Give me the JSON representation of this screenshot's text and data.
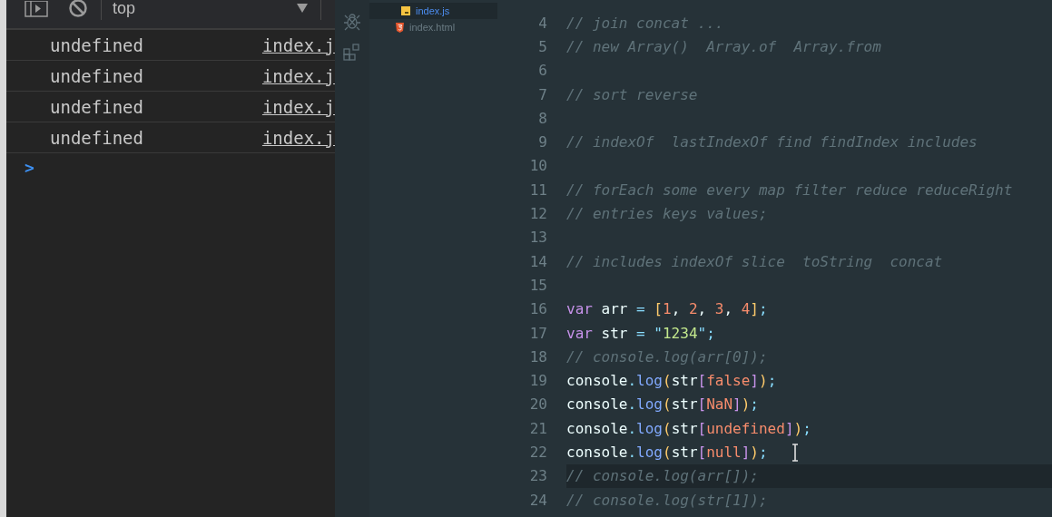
{
  "console": {
    "toolbar": {
      "context": "top"
    },
    "messages": [
      {
        "text": "undefined",
        "source": "index.j"
      },
      {
        "text": "undefined",
        "source": "index.j"
      },
      {
        "text": "undefined",
        "source": "index.j"
      },
      {
        "text": "undefined",
        "source": "index.j"
      }
    ],
    "prompt": ">"
  },
  "file_tree": {
    "items": [
      {
        "name": "index.js",
        "kind": "js",
        "selected": true
      },
      {
        "name": "index.html",
        "kind": "html",
        "selected": false
      }
    ]
  },
  "editor": {
    "lines": [
      {
        "number": "4",
        "current": false,
        "tokens": [
          {
            "text": "// join concat ...",
            "kind": "comment"
          }
        ]
      },
      {
        "number": "5",
        "current": false,
        "tokens": [
          {
            "text": "// new Array()  Array.of  Array.from",
            "kind": "comment"
          }
        ]
      },
      {
        "number": "6",
        "current": false
      },
      {
        "number": "7",
        "current": false,
        "tokens": [
          {
            "text": "// sort reverse",
            "kind": "comment"
          }
        ]
      },
      {
        "number": "8",
        "current": false
      },
      {
        "number": "9",
        "current": false,
        "tokens": [
          {
            "text": "// indexOf  lastIndexOf find findIndex includes",
            "kind": "comment"
          }
        ]
      },
      {
        "number": "10",
        "current": false
      },
      {
        "number": "11",
        "current": false,
        "tokens": [
          {
            "text": "// forEach some every map filter reduce reduceRight",
            "kind": "comment"
          }
        ]
      },
      {
        "number": "12",
        "current": false,
        "tokens": [
          {
            "text": "// entries keys values;",
            "kind": "comment"
          }
        ]
      },
      {
        "number": "13",
        "current": false
      },
      {
        "number": "14",
        "current": false,
        "tokens": [
          {
            "text": "// includes indexOf slice  toString  concat",
            "kind": "comment"
          }
        ]
      },
      {
        "number": "15",
        "current": false
      },
      {
        "number": "16",
        "current": false,
        "tokens": [
          {
            "text": "var",
            "kind": "keyword"
          },
          {
            "text": " arr ",
            "kind": "plain"
          },
          {
            "text": "= ",
            "kind": "operator"
          },
          {
            "text": "[",
            "kind": "paren"
          },
          {
            "text": "1",
            "kind": "number"
          },
          {
            "text": ", ",
            "kind": "plain"
          },
          {
            "text": "2",
            "kind": "number"
          },
          {
            "text": ", ",
            "kind": "plain"
          },
          {
            "text": "3",
            "kind": "number"
          },
          {
            "text": ", ",
            "kind": "plain"
          },
          {
            "text": "4",
            "kind": "number"
          },
          {
            "text": "]",
            "kind": "paren"
          },
          {
            "text": ";",
            "kind": "punct"
          }
        ]
      },
      {
        "number": "17",
        "current": false,
        "tokens": [
          {
            "text": "var",
            "kind": "keyword"
          },
          {
            "text": " str ",
            "kind": "plain"
          },
          {
            "text": "= ",
            "kind": "operator"
          },
          {
            "text": "\"",
            "kind": "punct"
          },
          {
            "text": "1234",
            "kind": "string"
          },
          {
            "text": "\"",
            "kind": "punct"
          },
          {
            "text": ";",
            "kind": "punct"
          }
        ]
      },
      {
        "number": "18",
        "current": false,
        "tokens": [
          {
            "text": "// console.log(arr[0]);",
            "kind": "comment"
          }
        ]
      },
      {
        "number": "19",
        "current": false,
        "tokens": [
          {
            "text": "console",
            "kind": "plain"
          },
          {
            "text": ".",
            "kind": "punct"
          },
          {
            "text": "log",
            "kind": "method"
          },
          {
            "text": "(",
            "kind": "paren"
          },
          {
            "text": "str",
            "kind": "plain"
          },
          {
            "text": "[",
            "kind": "bracket"
          },
          {
            "text": "false",
            "kind": "number"
          },
          {
            "text": "]",
            "kind": "bracket"
          },
          {
            "text": ")",
            "kind": "paren"
          },
          {
            "text": ";",
            "kind": "punct"
          }
        ]
      },
      {
        "number": "20",
        "current": false,
        "tokens": [
          {
            "text": "console",
            "kind": "plain"
          },
          {
            "text": ".",
            "kind": "punct"
          },
          {
            "text": "log",
            "kind": "method"
          },
          {
            "text": "(",
            "kind": "paren"
          },
          {
            "text": "str",
            "kind": "plain"
          },
          {
            "text": "[",
            "kind": "bracket"
          },
          {
            "text": "NaN",
            "kind": "number"
          },
          {
            "text": "]",
            "kind": "bracket"
          },
          {
            "text": ")",
            "kind": "paren"
          },
          {
            "text": ";",
            "kind": "punct"
          }
        ]
      },
      {
        "number": "21",
        "current": false,
        "tokens": [
          {
            "text": "console",
            "kind": "plain"
          },
          {
            "text": ".",
            "kind": "punct"
          },
          {
            "text": "log",
            "kind": "method"
          },
          {
            "text": "(",
            "kind": "paren"
          },
          {
            "text": "str",
            "kind": "plain"
          },
          {
            "text": "[",
            "kind": "bracket"
          },
          {
            "text": "undefined",
            "kind": "number"
          },
          {
            "text": "]",
            "kind": "bracket"
          },
          {
            "text": ")",
            "kind": "paren"
          },
          {
            "text": ";",
            "kind": "punct"
          }
        ]
      },
      {
        "number": "22",
        "current": false,
        "cursor": true,
        "tokens": [
          {
            "text": "console",
            "kind": "plain"
          },
          {
            "text": ".",
            "kind": "punct"
          },
          {
            "text": "log",
            "kind": "method"
          },
          {
            "text": "(",
            "kind": "paren"
          },
          {
            "text": "str",
            "kind": "plain"
          },
          {
            "text": "[",
            "kind": "bracket"
          },
          {
            "text": "null",
            "kind": "number"
          },
          {
            "text": "]",
            "kind": "bracket"
          },
          {
            "text": ")",
            "kind": "paren"
          },
          {
            "text": ";",
            "kind": "punct"
          }
        ]
      },
      {
        "number": "23",
        "current": true,
        "tokens": [
          {
            "text": "// console.log(arr[]);",
            "kind": "comment"
          }
        ]
      },
      {
        "number": "24",
        "current": false,
        "tokens": [
          {
            "text": "// console.log(str[1]);",
            "kind": "comment"
          }
        ]
      }
    ]
  }
}
